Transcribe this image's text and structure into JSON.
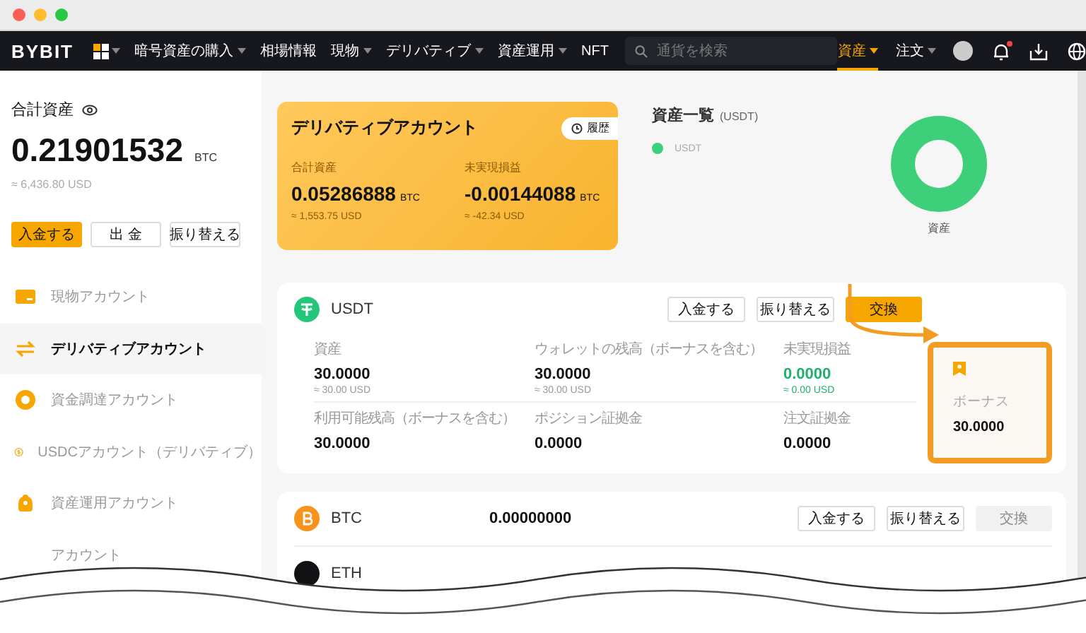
{
  "nav": {
    "logo": "BYBIT",
    "items": [
      {
        "label": "暗号資産の購入",
        "dropdown": true
      },
      {
        "label": "相場情報",
        "dropdown": false
      },
      {
        "label": "現物",
        "dropdown": true
      },
      {
        "label": "デリバティブ",
        "dropdown": true
      },
      {
        "label": "資産運用",
        "dropdown": true
      },
      {
        "label": "NFT",
        "dropdown": false
      }
    ],
    "search": {
      "placeholder": "通貨を検索"
    },
    "right_items": [
      {
        "label": "資産",
        "selected": true
      },
      {
        "label": "注文",
        "selected": false
      }
    ],
    "notification_badge": true
  },
  "summary": {
    "title": "合計資産",
    "amount": "0.21901532",
    "unit": "BTC",
    "usd": "≈ 6,436.80 USD",
    "buttons": [
      {
        "label": "入金する",
        "kind": "primary"
      },
      {
        "label": "出 金",
        "kind": "outline"
      },
      {
        "label": "振り替える",
        "kind": "outline"
      }
    ]
  },
  "derivatives_card": {
    "title": "デリバティブアカウント",
    "history_button": "履歴",
    "metrics": [
      {
        "label": "合計資産",
        "value": "0.05286888",
        "unit": "BTC",
        "usd": "≈ 1,553.75 USD"
      },
      {
        "label": "未実現損益",
        "value": "-0.00144088",
        "unit": "BTC",
        "usd": "≈ -42.34 USD"
      }
    ]
  },
  "overview": {
    "title": "資産一覧",
    "unit": "(USDT)",
    "legend": [
      {
        "label": "USDT",
        "color": "#3ecf7b"
      }
    ],
    "chart_label": "資産"
  },
  "sidebar": {
    "items": [
      {
        "label": "現物アカウント",
        "kind": "card",
        "selected": false
      },
      {
        "label": "デリバティブアカウント",
        "kind": "swap",
        "selected": true
      },
      {
        "label": "資金調達アカウント",
        "kind": "coin",
        "selected": false
      },
      {
        "label": "USDCアカウント（デリバティブ）",
        "kind": "dollar",
        "selected": false
      },
      {
        "label": "資産運用アカウント",
        "kind": "piggy",
        "selected": false
      },
      {
        "label": "アカウント",
        "kind": "hidden",
        "selected": false
      }
    ]
  },
  "usdt_panel": {
    "symbol": "USDT",
    "buttons": [
      {
        "label": "入金する",
        "kind": "outline",
        "disabled": false
      },
      {
        "label": "振り替える",
        "kind": "outline",
        "disabled": false
      },
      {
        "label": "交換",
        "kind": "primary",
        "disabled": false
      }
    ],
    "fields": [
      {
        "label": "資産",
        "value": "30.0000",
        "usd": "≈ 30.00 USD",
        "positive": false
      },
      {
        "label": "ウォレットの残高（ボーナスを含む）",
        "value": "30.0000",
        "usd": "≈ 30.00 USD",
        "positive": false
      },
      {
        "label": "未実現損益",
        "value": "0.0000",
        "usd": "≈ 0.00 USD",
        "positive": true
      },
      {
        "label": "利用可能残高（ボーナスを含む）",
        "value": "30.0000",
        "positive": false
      },
      {
        "label": "ポジション証拠金",
        "value": "0.0000",
        "positive": false
      },
      {
        "label": "注文証拠金",
        "value": "0.0000",
        "positive": false
      }
    ],
    "bonus": {
      "label": "ボーナス",
      "value": "30.0000",
      "highlighted": true
    }
  },
  "asset_rows": [
    {
      "symbol": "BTC",
      "kind": "btc",
      "amount": "0.00000000",
      "buttons": [
        {
          "label": "入金する",
          "kind": "outline",
          "disabled": false
        },
        {
          "label": "振り替える",
          "kind": "outline",
          "disabled": false
        },
        {
          "label": "交換",
          "kind": "primary",
          "disabled": true
        }
      ]
    },
    {
      "symbol": "ETH",
      "kind": "eth"
    }
  ]
}
